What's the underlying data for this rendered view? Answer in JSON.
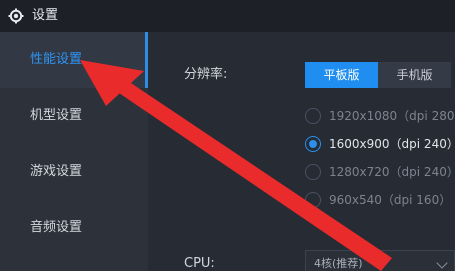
{
  "window": {
    "title": "设置",
    "icon": "gear-icon"
  },
  "sidebar": {
    "items": [
      {
        "label": "性能设置",
        "active": true
      },
      {
        "label": "机型设置",
        "active": false
      },
      {
        "label": "游戏设置",
        "active": false
      },
      {
        "label": "音频设置",
        "active": false
      }
    ]
  },
  "content": {
    "resolution": {
      "label": "分辨率:",
      "segments": [
        {
          "label": "平板版",
          "selected": true
        },
        {
          "label": "手机版",
          "selected": false
        }
      ],
      "options": [
        {
          "label": "1920x1080（dpi 280）",
          "selected": false
        },
        {
          "label": "1600x900（dpi 240）",
          "selected": true
        },
        {
          "label": "1280x720（dpi 240）",
          "selected": false
        },
        {
          "label": "960x540（dpi 160）",
          "selected": false
        }
      ]
    },
    "cpu": {
      "label": "CPU:",
      "value": "4核(推荐)"
    }
  },
  "colors": {
    "accent": "#1f8ef0",
    "arrow": "#ea2b2b",
    "titlebar": "#1d2027",
    "sidebar": "#2c313a",
    "content": "#262b34"
  }
}
